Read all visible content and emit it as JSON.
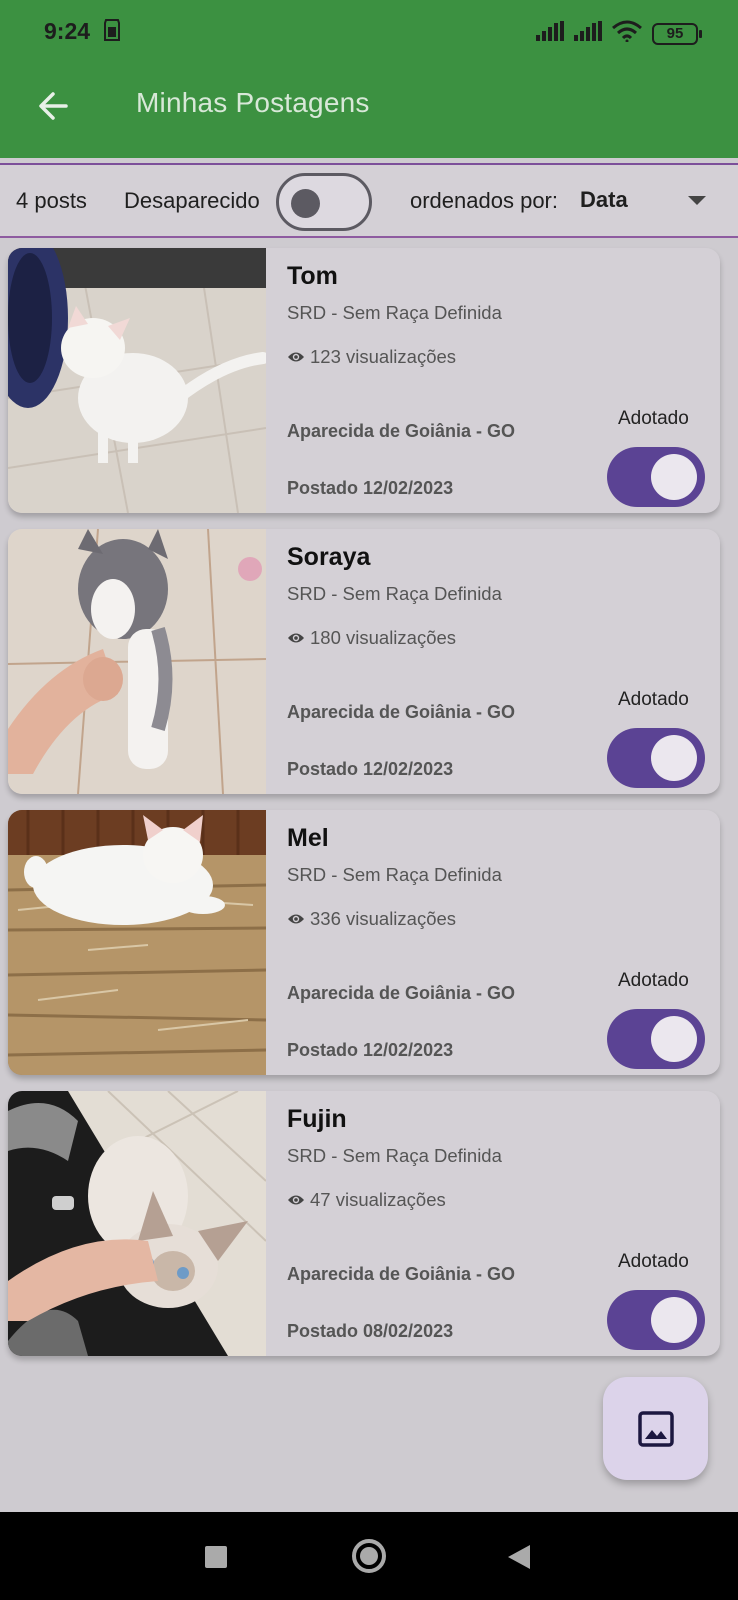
{
  "status_bar": {
    "time": "9:24",
    "battery": "95"
  },
  "app_bar": {
    "title": "Minhas Postagens"
  },
  "filters": {
    "post_count": "4 posts",
    "missing_label": "Desaparecido",
    "missing_on": false,
    "order_label": "ordenados por:",
    "order_value": "Data"
  },
  "posts": [
    {
      "name": "Tom",
      "breed": "SRD - Sem Raça Definida",
      "views": "123 visualizações",
      "city": "Aparecida de Goiânia - GO",
      "date": "Postado 12/02/2023",
      "status_label": "Adotado",
      "adopted": true
    },
    {
      "name": "Soraya",
      "breed": "SRD - Sem Raça Definida",
      "views": "180 visualizações",
      "city": "Aparecida de Goiânia - GO",
      "date": "Postado 12/02/2023",
      "status_label": "Adotado",
      "adopted": true
    },
    {
      "name": "Mel",
      "breed": "SRD - Sem Raça Definida",
      "views": "336 visualizações",
      "city": "Aparecida de Goiânia - GO",
      "date": "Postado 12/02/2023",
      "status_label": "Adotado",
      "adopted": true
    },
    {
      "name": "Fujin",
      "breed": "SRD - Sem Raça Definida",
      "views": "47 visualizações",
      "city": "Aparecida de Goiânia - GO",
      "date": "Postado 08/02/2023",
      "status_label": "Adotado",
      "adopted": true
    }
  ],
  "colors": {
    "app_bar": "#3c9141",
    "accent": "#5b4394",
    "background": "#cecbd0"
  },
  "icons": {
    "back": "arrow-left-icon",
    "views": "eye-icon",
    "fab": "image-icon",
    "dropdown": "caret-down-icon"
  }
}
